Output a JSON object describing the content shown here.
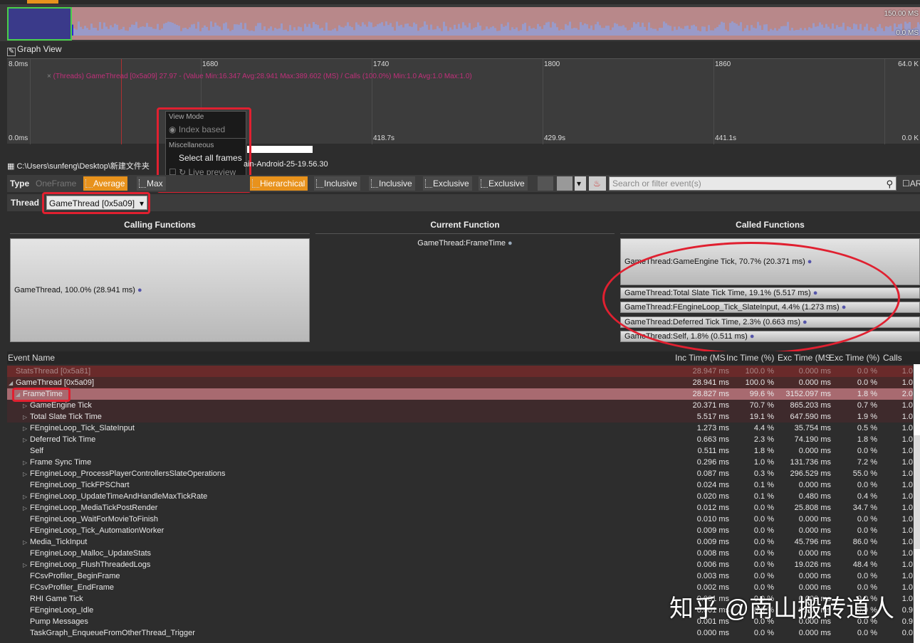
{
  "overview": {
    "max_label": "150.00 MS",
    "min_label": "0.0 MS"
  },
  "graph_view": {
    "title": "Graph View",
    "y_top_left": "8.0ms",
    "y_bottom_left": "0.0ms",
    "y_top_right": "64.0 K",
    "y_bottom_right": "0.0 K",
    "x_labels": [
      "1680",
      "1740",
      "1800",
      "1860"
    ],
    "time_labels": [
      "418.7s",
      "429.9s",
      "441.1s"
    ],
    "series_info": "(Threads) GameThread [0x5a09] 27.97 - (Value Min:16.347 Avg:28.941 Max:389.602 (MS) / Calls (100.0%) Min:1.0 Avg:1.0 Max:1.0)"
  },
  "popup": {
    "view_mode": "View Mode",
    "index_based": "Index based",
    "misc": "Miscellaneous",
    "select_all": "Select all frames",
    "live_preview": "Live preview"
  },
  "file_path": "C:\\Users\\sunfeng\\Desktop\\新建文件夹",
  "file_path_tail": "ain-Android-25-19.56.30",
  "toolbar": {
    "type_label": "Type",
    "one_frame": "OneFrame",
    "average": "Average",
    "max": "Max",
    "hierarchical": "Hierarchical",
    "inclusive1": "Inclusive",
    "inclusive2": "Inclusive",
    "exclusive1": "Exclusive",
    "exclusive2": "Exclusive",
    "search_placeholder": "Search or filter event(s)",
    "ar_label": "AR"
  },
  "thread": {
    "label": "Thread",
    "selected": "GameThread [0x5a09]"
  },
  "callgraph": {
    "calling_title": "Calling Functions",
    "current_title": "Current Function",
    "called_title": "Called Functions",
    "calling": "GameThread, 100.0% (28.941 ms)",
    "current": "GameThread:FrameTime",
    "called": [
      "GameThread:GameEngine Tick, 70.7% (20.371 ms)",
      "GameThread:Total Slate Tick Time, 19.1% (5.517 ms)",
      "GameThread:FEngineLoop_Tick_SlateInput, 4.4% (1.273 ms)",
      "GameThread:Deferred Tick Time, 2.3% (0.663 ms)",
      "GameThread:Self, 1.8% (0.511 ms)"
    ]
  },
  "table": {
    "headers": [
      "Event Name",
      "Inc Time (MS",
      "Inc Time (%)",
      "Exc Time (MS",
      "Exc Time (%)",
      "Calls"
    ],
    "rows": [
      [
        "StatsThread [0x5a81]",
        "28.947 ms",
        "100.0 %",
        "0.000 ms",
        "0.0 %",
        "1.0"
      ],
      [
        "GameThread [0x5a09]",
        "28.941 ms",
        "100.0 %",
        "0.000 ms",
        "0.0 %",
        "1.0"
      ],
      [
        "FrameTime",
        "28.827 ms",
        "99.6 %",
        "3152.097 ms",
        "1.8 %",
        "2.0"
      ],
      [
        "GameEngine Tick",
        "20.371 ms",
        "70.7 %",
        "865.203 ms",
        "0.7 %",
        "1.0"
      ],
      [
        "Total Slate Tick Time",
        "5.517 ms",
        "19.1 %",
        "647.590 ms",
        "1.9 %",
        "1.0"
      ],
      [
        "FEngineLoop_Tick_SlateInput",
        "1.273 ms",
        "4.4 %",
        "35.754 ms",
        "0.5 %",
        "1.0"
      ],
      [
        "Deferred Tick Time",
        "0.663 ms",
        "2.3 %",
        "74.190 ms",
        "1.8 %",
        "1.0"
      ],
      [
        "Self",
        "0.511 ms",
        "1.8 %",
        "0.000 ms",
        "0.0 %",
        "1.0"
      ],
      [
        "Frame Sync Time",
        "0.296 ms",
        "1.0 %",
        "131.736 ms",
        "7.2 %",
        "1.0"
      ],
      [
        "FEngineLoop_ProcessPlayerControllersSlateOperations",
        "0.087 ms",
        "0.3 %",
        "296.529 ms",
        "55.0 %",
        "1.0"
      ],
      [
        "FEngineLoop_TickFPSChart",
        "0.024 ms",
        "0.1 %",
        "0.000 ms",
        "0.0 %",
        "1.0"
      ],
      [
        "FEngineLoop_UpdateTimeAndHandleMaxTickRate",
        "0.020 ms",
        "0.1 %",
        "0.480 ms",
        "0.4 %",
        "1.0"
      ],
      [
        "FEngineLoop_MediaTickPostRender",
        "0.012 ms",
        "0.0 %",
        "25.808 ms",
        "34.7 %",
        "1.0"
      ],
      [
        "FEngineLoop_WaitForMovieToFinish",
        "0.010 ms",
        "0.0 %",
        "0.000 ms",
        "0.0 %",
        "1.0"
      ],
      [
        "FEngineLoop_Tick_AutomationWorker",
        "0.009 ms",
        "0.0 %",
        "0.000 ms",
        "0.0 %",
        "1.0"
      ],
      [
        "Media_TickInput",
        "0.009 ms",
        "0.0 %",
        "45.796 ms",
        "86.0 %",
        "1.0"
      ],
      [
        "FEngineLoop_Malloc_UpdateStats",
        "0.008 ms",
        "0.0 %",
        "0.000 ms",
        "0.0 %",
        "1.0"
      ],
      [
        "FEngineLoop_FlushThreadedLogs",
        "0.006 ms",
        "0.0 %",
        "19.026 ms",
        "48.4 %",
        "1.0"
      ],
      [
        "FCsvProfiler_BeginFrame",
        "0.003 ms",
        "0.0 %",
        "0.000 ms",
        "0.0 %",
        "1.0"
      ],
      [
        "FCsvProfiler_EndFrame",
        "0.002 ms",
        "0.0 %",
        "0.000 ms",
        "0.0 %",
        "1.0"
      ],
      [
        "RHI Game Tick",
        "0.001 ms",
        "0.0 %",
        "0.000 ms",
        "0.0 %",
        "1.0"
      ],
      [
        "FEngineLoop_Idle",
        "0.001 ms",
        "0.0 %",
        "0.000 ms",
        "0.0 %",
        "0.9"
      ],
      [
        "Pump Messages",
        "0.001 ms",
        "0.0 %",
        "0.000 ms",
        "0.0 %",
        "0.9"
      ],
      [
        "TaskGraph_EnqueueFromOtherThread_Trigger",
        "0.000 ms",
        "0.0 %",
        "0.000 ms",
        "0.0 %",
        "0.0"
      ]
    ],
    "expandable": [
      false,
      false,
      true,
      true,
      true,
      true,
      true,
      false,
      true,
      true,
      false,
      true,
      true,
      false,
      false,
      true,
      false,
      true,
      false,
      false,
      false,
      false,
      false,
      false
    ]
  },
  "watermark": "知乎 @南山搬砖道人"
}
